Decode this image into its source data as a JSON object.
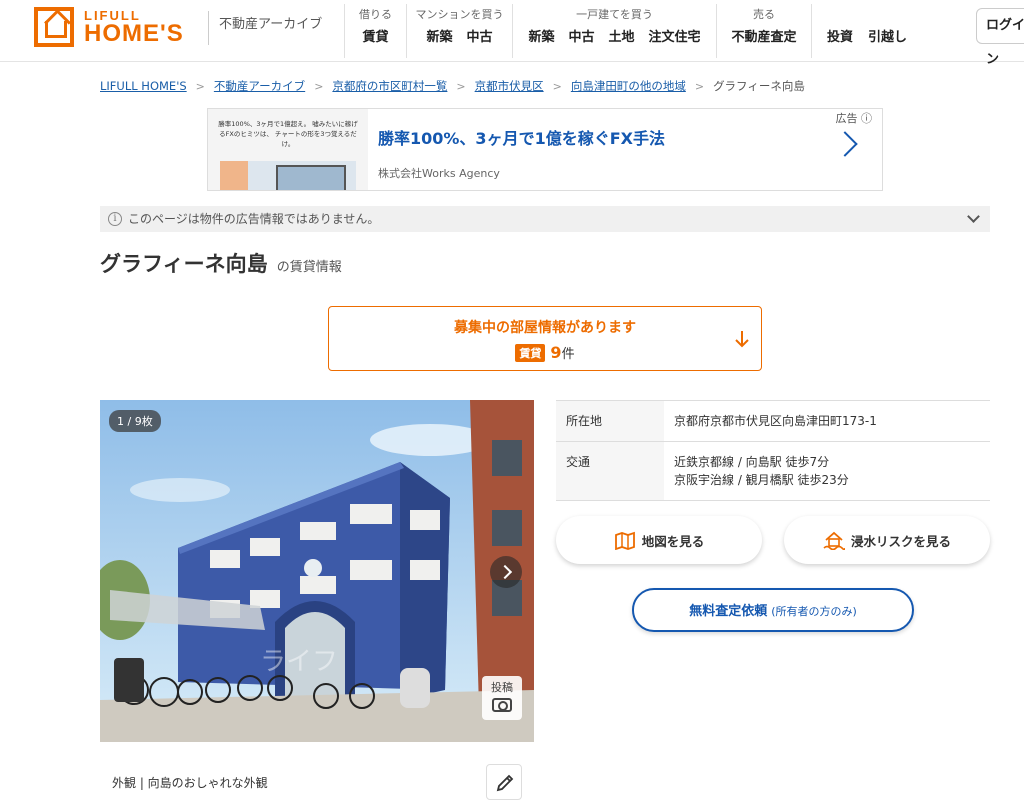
{
  "header": {
    "logo_top": "LIFULL",
    "logo_bottom": "HOME'S",
    "archive_label": "不動産アーカイブ",
    "nav_groups": [
      {
        "title": "借りる",
        "items": [
          "賃貸"
        ]
      },
      {
        "title": "マンションを買う",
        "items": [
          "新築",
          "中古"
        ]
      },
      {
        "title": "一戸建てを買う",
        "items": [
          "新築",
          "中古",
          "土地",
          "注文住宅"
        ]
      },
      {
        "title": "売る",
        "items": [
          "不動産査定"
        ]
      }
    ],
    "nav_plain": [
      "投資",
      "引越し"
    ],
    "login_label": "ログイン"
  },
  "breadcrumb": {
    "items": [
      "LIFULL HOME'S",
      "不動産アーカイブ",
      "京都府の市区町村一覧",
      "京都市伏見区",
      "向島津田町の他の地域"
    ],
    "current": "グラフィーネ向島"
  },
  "ad": {
    "thumb_text": "勝率100%、3ヶ月で1億超え。 噓みたいに稼げるFXのヒミツは、 チャートの形を3つ覚えるだけ。",
    "title": "勝率100%、3ヶ月で1億を稼ぐFX手法",
    "company": "株式会社Works Agency",
    "label": "広告"
  },
  "notice": {
    "text": "このページは物件の広告情報ではありません。",
    "info_glyph": "i"
  },
  "property": {
    "name": "グラフィーネ向島",
    "suffix": "の賃貸情報"
  },
  "vacancy": {
    "title": "募集中の部屋情報があります",
    "badge": "賃貸",
    "count": "9",
    "unit": "件"
  },
  "photo": {
    "counter": "1 / 9枚",
    "post_label": "投稿",
    "caption": "外観 | 向島のおしゃれな外観",
    "watermark": "ライフ"
  },
  "info": {
    "rows": [
      {
        "label": "所在地",
        "lines": [
          "京都府京都市伏見区向島津田町173-1"
        ]
      },
      {
        "label": "交通",
        "lines": [
          "近鉄京都線 / 向島駅 徒歩7分",
          "京阪宇治線 / 観月橋駅 徒歩23分"
        ]
      }
    ]
  },
  "buttons": {
    "map": "地図を見る",
    "flood": "浸水リスクを見る",
    "appraisal_main": "無料査定依頼",
    "appraisal_sub": "(所有者の方のみ)"
  },
  "colors": {
    "brand_orange": "#ed6c00",
    "link_blue": "#1a5ea8",
    "appraisal_blue": "#1558b0"
  }
}
